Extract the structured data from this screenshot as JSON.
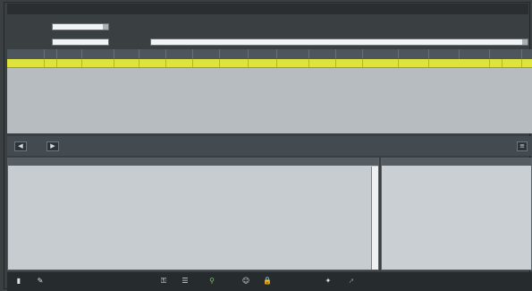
{
  "window": {
    "title": ""
  },
  "form": {
    "row1": {
      "label": "",
      "value": "",
      "extra": ""
    },
    "row2": {
      "label": "",
      "value": "",
      "label2": "",
      "value2": ""
    }
  },
  "grid": {
    "columns": [
      "",
      "",
      "",
      "",
      "",
      "",
      "",
      "",
      "",
      "",
      "",
      "",
      "",
      "",
      "",
      "",
      "",
      "",
      ""
    ],
    "selected_row": {
      "first_cell": "",
      "last_cell": ""
    }
  },
  "nav": {
    "prev_label": "◀",
    "next_label": "▶"
  },
  "left_panel": {
    "title": "",
    "log": ""
  },
  "right_panel": {
    "title": "",
    "text": ""
  },
  "colors": {
    "selection": "#dfe43c",
    "background": "#3a3f42"
  },
  "toolbar": {
    "icons": [
      "door-icon",
      "pen-icon",
      "key-icon",
      "list-icon",
      "search-icon",
      "user-icon",
      "lock-icon",
      "pin-icon",
      "pointer-icon"
    ]
  }
}
